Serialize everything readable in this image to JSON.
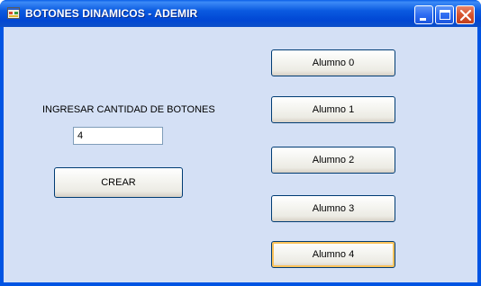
{
  "window": {
    "title": "BOTONES DINAMICOS - ADEMIR",
    "controls": {
      "minimize": "minimize-icon",
      "maximize": "maximize-icon",
      "close": "close-icon"
    }
  },
  "form": {
    "label": "INGRESAR CANTIDAD DE BOTONES",
    "quantity_value": "4",
    "create_button": "CREAR"
  },
  "dynamic_buttons": [
    {
      "label": "Alumno 0"
    },
    {
      "label": "Alumno 1"
    },
    {
      "label": "Alumno 2"
    },
    {
      "label": "Alumno 3"
    },
    {
      "label": "Alumno 4",
      "focused": true
    }
  ],
  "colors": {
    "titlebar": "#0054e3",
    "client_background": "#d4e0f5",
    "button_border": "#003c74",
    "focus_ring": "#f9c25b"
  }
}
